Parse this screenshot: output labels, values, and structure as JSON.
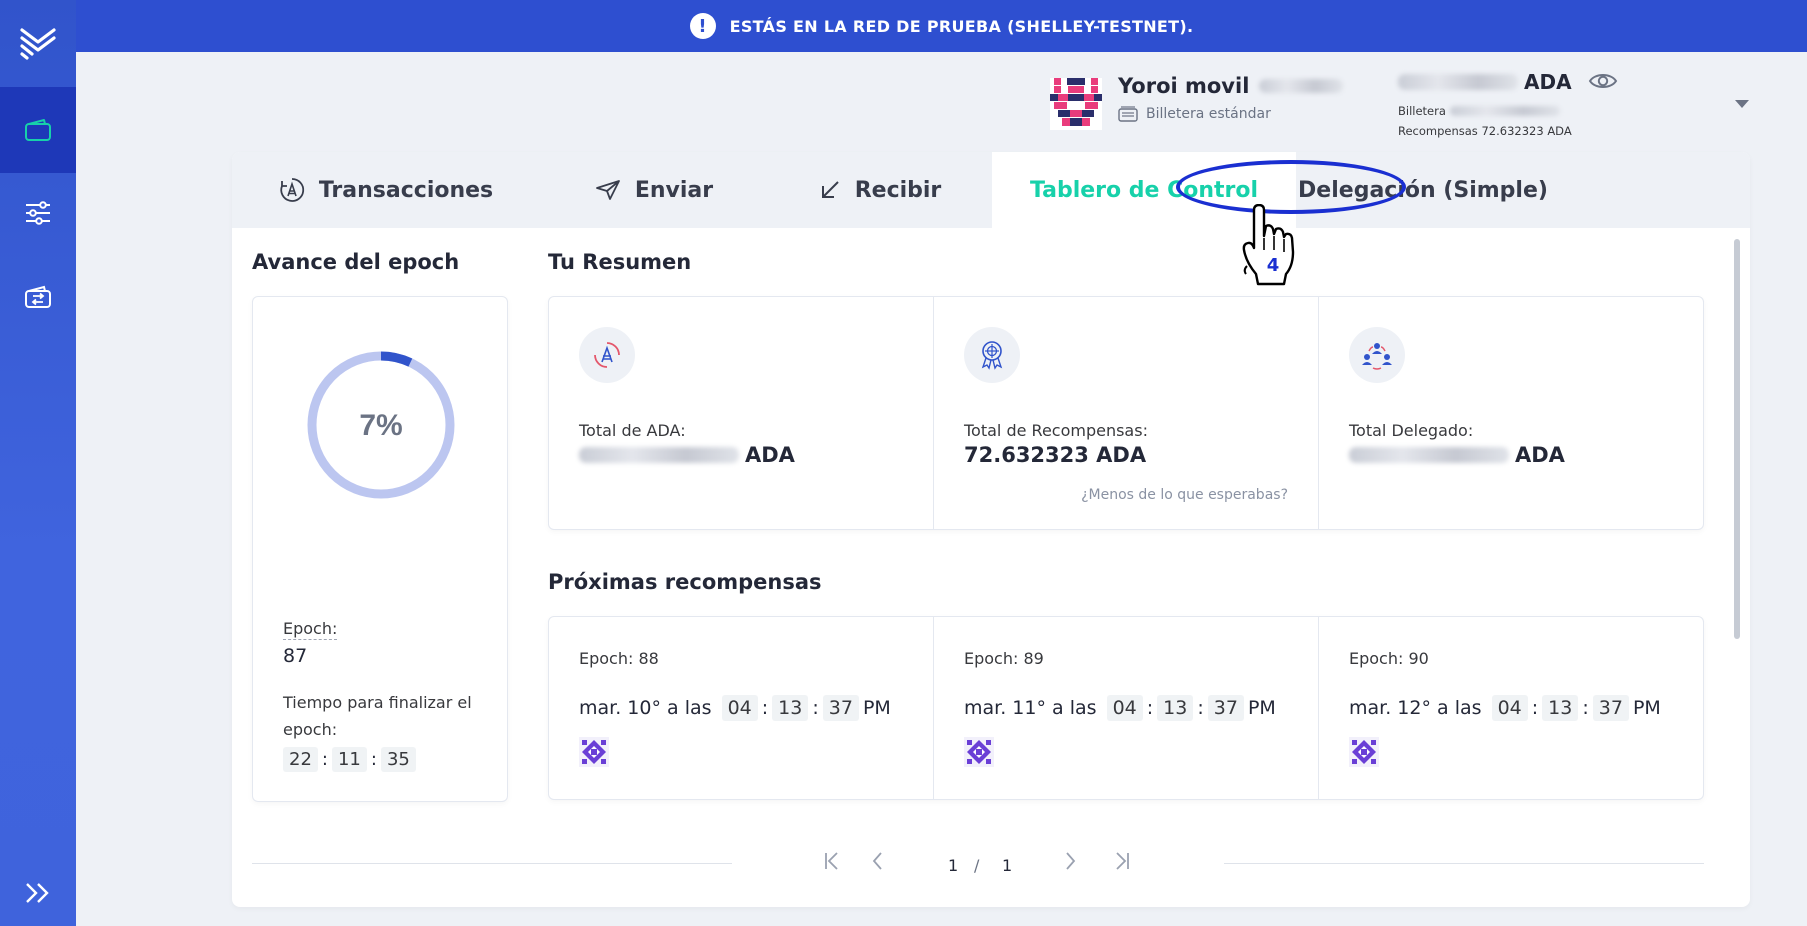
{
  "banner": {
    "text": "ESTÁS EN LA RED DE PRUEBA (SHELLEY-TESTNET)."
  },
  "wallet": {
    "name": "Yoroi movil",
    "type": "Billetera estándar",
    "balance_unit": "ADA",
    "balance_label": "Billetera",
    "rewards_label": "Recompensas",
    "rewards_value": "72.632323 ADA"
  },
  "tabs": [
    {
      "label": "Transacciones",
      "icon": "ada-transactions-icon"
    },
    {
      "label": "Enviar",
      "icon": "send-icon"
    },
    {
      "label": "Recibir",
      "icon": "receive-icon"
    },
    {
      "label": "Tablero de Control",
      "icon": "",
      "active": true
    },
    {
      "label": "Delegación (Simple)",
      "icon": ""
    }
  ],
  "annotation": {
    "step": "4"
  },
  "epoch_progress": {
    "title": "Avance del epoch",
    "percent_label": "7%",
    "percent": 7,
    "epoch_label": "Epoch:",
    "epoch_value": "87",
    "time_label": "Tiempo para finalizar el epoch:",
    "time": {
      "h": "22",
      "m": "11",
      "s": "35"
    }
  },
  "summary": {
    "title": "Tu Resumen",
    "items": [
      {
        "label": "Total de ADA:",
        "value": "ADA",
        "icon": "ada-cycle-icon"
      },
      {
        "label": "Total de Recompensas:",
        "value": "72.632323 ADA",
        "icon": "rewards-medal-icon",
        "link": "¿Menos de lo que esperabas?"
      },
      {
        "label": "Total Delegado:",
        "value": "ADA",
        "icon": "delegation-people-icon"
      }
    ]
  },
  "upcoming": {
    "title": "Próximas recompensas",
    "items": [
      {
        "epoch": "Epoch: 88",
        "date": "mar. 10° a las",
        "h": "04",
        "m": "13",
        "s": "37",
        "ampm": "PM"
      },
      {
        "epoch": "Epoch: 89",
        "date": "mar. 11° a las",
        "h": "04",
        "m": "13",
        "s": "37",
        "ampm": "PM"
      },
      {
        "epoch": "Epoch: 90",
        "date": "mar. 12° a las",
        "h": "04",
        "m": "13",
        "s": "37",
        "ampm": "PM"
      }
    ]
  },
  "pagination": {
    "current": "1",
    "sep": "/",
    "total": "1"
  },
  "colors": {
    "accent": "#17d1aa",
    "sidebar": "#3154cb",
    "banner": "#2e4fd0"
  }
}
